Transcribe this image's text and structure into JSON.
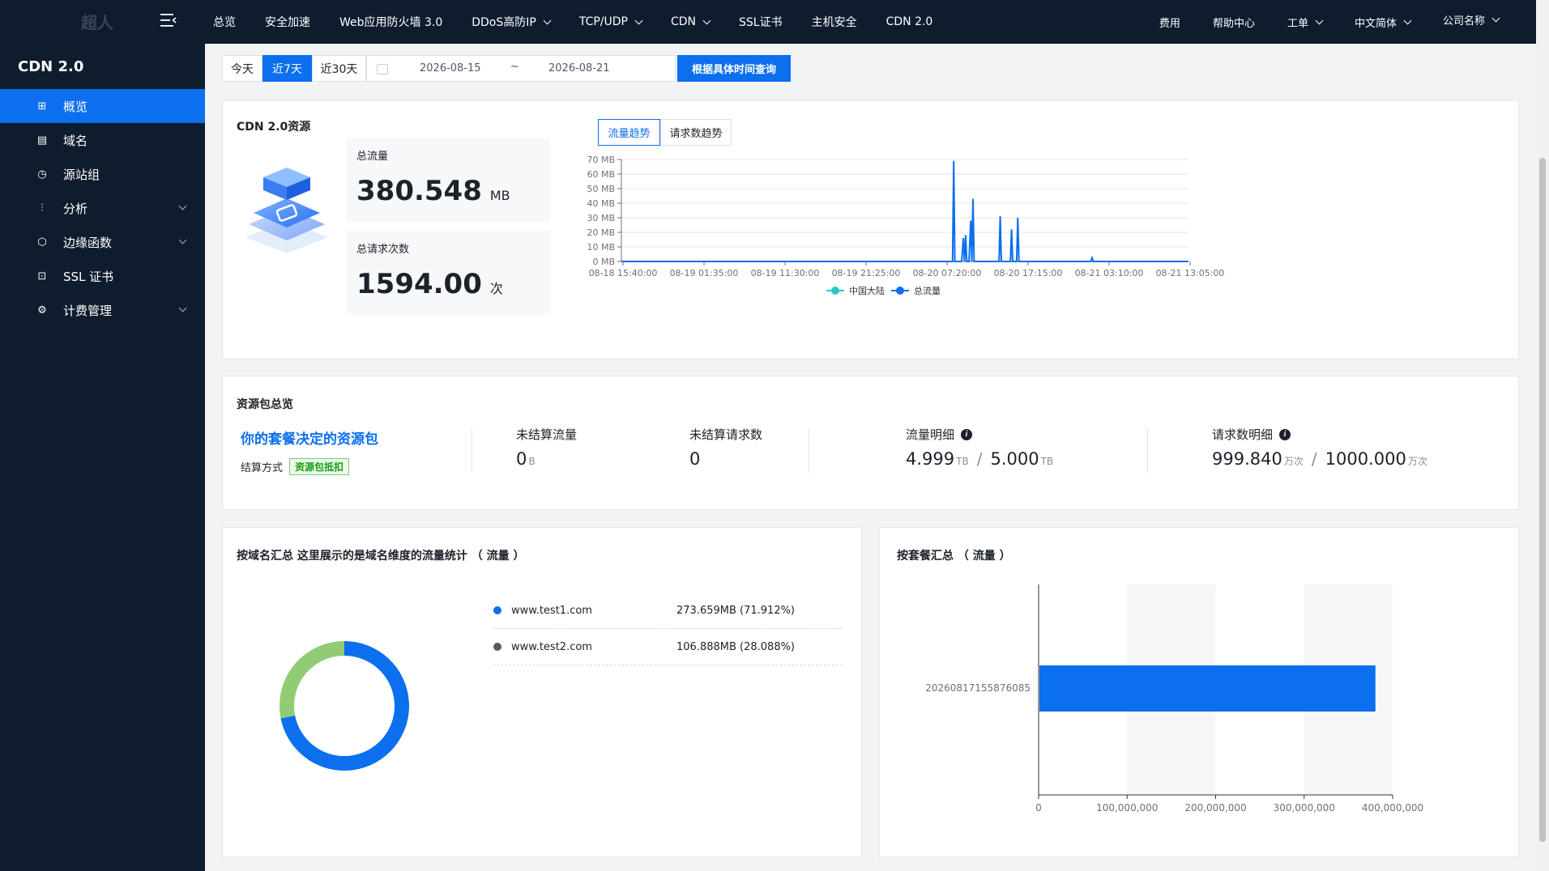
{
  "header": {
    "logo_text": "超人",
    "nav": [
      {
        "label": "总览",
        "dropdown": false
      },
      {
        "label": "安全加速",
        "dropdown": false
      },
      {
        "label": "Web应用防火墙 3.0",
        "dropdown": false
      },
      {
        "label": "DDoS高防IP",
        "dropdown": true
      },
      {
        "label": "TCP/UDP",
        "dropdown": true
      },
      {
        "label": "CDN",
        "dropdown": true
      },
      {
        "label": "SSL证书",
        "dropdown": false
      },
      {
        "label": "主机安全",
        "dropdown": false
      },
      {
        "label": "CDN 2.0",
        "dropdown": false
      }
    ],
    "right": {
      "fees": "费用",
      "help": "帮助中心",
      "ticket": "工单",
      "language": "中文简体",
      "company": "公司名称"
    }
  },
  "sidebar": {
    "title": "CDN 2.0",
    "items": [
      {
        "label": "概览",
        "icon": "grid-icon",
        "active": true,
        "expandable": false
      },
      {
        "label": "域名",
        "icon": "domain-icon",
        "active": false,
        "expandable": false
      },
      {
        "label": "源站组",
        "icon": "origin-icon",
        "active": false,
        "expandable": false
      },
      {
        "label": "分析",
        "icon": "chart-icon",
        "active": false,
        "expandable": true
      },
      {
        "label": "边缘函数",
        "icon": "hexagon-icon",
        "active": false,
        "expandable": true
      },
      {
        "label": "SSL 证书",
        "icon": "certificate-icon",
        "active": false,
        "expandable": false
      },
      {
        "label": "计费管理",
        "icon": "billing-icon",
        "active": false,
        "expandable": true
      }
    ]
  },
  "filter": {
    "today": "今天",
    "week": "近7天",
    "month": "近30天",
    "start_date": "2026-08-15",
    "tilde": "~",
    "end_date": "2026-08-21",
    "query_button": "根据具体时间查询"
  },
  "resource": {
    "title": "CDN 2.0资源",
    "total_traffic_label": "总流量",
    "total_traffic_value": "380.548",
    "total_traffic_unit": "MB",
    "total_requests_label": "总请求次数",
    "total_requests_value": "1594.00",
    "total_requests_unit": "次",
    "tab_traffic": "流量趋势",
    "tab_requests": "请求数趋势"
  },
  "chart_data": [
    {
      "type": "line",
      "title": "",
      "xlabel": "",
      "ylabel": "",
      "ylim": [
        0,
        70
      ],
      "y_ticks": [
        "0 MB",
        "10 MB",
        "20 MB",
        "30 MB",
        "40 MB",
        "50 MB",
        "60 MB",
        "70 MB"
      ],
      "x_ticks": [
        "08-18 15:40:00",
        "08-19 01:35:00",
        "08-19 11:30:00",
        "08-19 21:25:00",
        "08-20 07:20:00",
        "08-20 17:15:00",
        "08-21 03:10:00",
        "08-21 13:05:00"
      ],
      "legend": "bottom-center",
      "grid": true,
      "series": [
        {
          "name": "中国大陆",
          "color": "#2ec7c9",
          "values": []
        },
        {
          "name": "总流量",
          "color": "#0b6fee",
          "points": [
            [
              0.0,
              0
            ],
            [
              0.584,
              0
            ],
            [
              0.586,
              69
            ],
            [
              0.588,
              0
            ],
            [
              0.6,
              0
            ],
            [
              0.603,
              16
            ],
            [
              0.605,
              0
            ],
            [
              0.607,
              18
            ],
            [
              0.609,
              0
            ],
            [
              0.613,
              0
            ],
            [
              0.616,
              28
            ],
            [
              0.618,
              0
            ],
            [
              0.62,
              43
            ],
            [
              0.622,
              0
            ],
            [
              0.666,
              0
            ],
            [
              0.668,
              31
            ],
            [
              0.67,
              0
            ],
            [
              0.686,
              0
            ],
            [
              0.688,
              22
            ],
            [
              0.69,
              0
            ],
            [
              0.697,
              0
            ],
            [
              0.699,
              30
            ],
            [
              0.701,
              0
            ],
            [
              0.828,
              0
            ],
            [
              0.83,
              2.5
            ],
            [
              0.832,
              0
            ],
            [
              1.0,
              0
            ]
          ]
        }
      ]
    },
    {
      "type": "bar",
      "orientation": "horizontal",
      "title": "",
      "categories": [
        "20260817155876085"
      ],
      "values": [
        380548000
      ],
      "xlim": [
        0,
        400000000
      ],
      "x_ticks": [
        "0",
        "100,000,000",
        "200,000,000",
        "300,000,000",
        "400,000,000"
      ],
      "color": "#0b6fee",
      "grid": true
    }
  ],
  "package": {
    "title": "资源包总览",
    "link": "你的套餐决定的资源包",
    "settle_label": "结算方式",
    "settle_badge": "资源包抵扣",
    "unsettled_traffic_label": "未结算流量",
    "unsettled_traffic_value": "0",
    "unsettled_traffic_unit": "B",
    "unsettled_requests_label": "未结算请求数",
    "unsettled_requests_value": "0",
    "traffic_detail_label": "流量明细",
    "traffic_used": "4.999",
    "traffic_used_unit": "TB",
    "traffic_total": "5.000",
    "traffic_total_unit": "TB",
    "request_detail_label": "请求数明细",
    "request_used": "999.840",
    "request_used_unit": "万次",
    "request_total": "1000.000",
    "request_total_unit": "万次",
    "sep": "/",
    "info": "i"
  },
  "domain_summary": {
    "title": "按域名汇总 这里展示的是域名维度的流量统计 （ 流量 ）",
    "items": [
      {
        "domain": "www.test1.com",
        "value": "273.659MB (71.912%)",
        "color": "#0b6fee",
        "share": 71.912
      },
      {
        "domain": "www.test2.com",
        "value": "106.888MB (28.088%)",
        "color": "#91cc75",
        "dot_color": "#595959",
        "share": 28.088
      }
    ]
  },
  "plan_summary": {
    "title": "按套餐汇总 （ 流量 ）"
  }
}
